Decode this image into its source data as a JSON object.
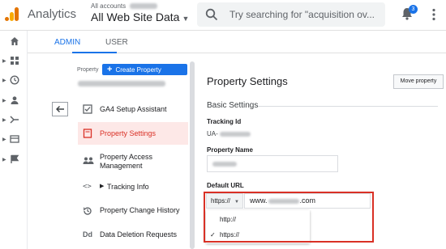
{
  "header": {
    "app_title": "Analytics",
    "account_small": "All accounts",
    "account_main": "All Web Site Data",
    "search_placeholder": "Try searching for \"acquisition ov...",
    "notifications_count": "3"
  },
  "tabs": [
    {
      "label": "ADMIN",
      "active": true
    },
    {
      "label": "USER",
      "active": false
    }
  ],
  "property": {
    "label": "Property",
    "create_button": "Create Property"
  },
  "menu": [
    {
      "label": "GA4 Setup Assistant",
      "icon": "checkbox-icon",
      "selected": false
    },
    {
      "label": "Property Settings",
      "icon": "settings-page-icon",
      "selected": true
    },
    {
      "label": "Property Access Management",
      "icon": "people-icon",
      "selected": false
    },
    {
      "label": "Tracking Info",
      "icon": "code-icon",
      "selected": false
    },
    {
      "label": "Property Change History",
      "icon": "history-icon",
      "selected": false
    },
    {
      "label": "Data Deletion Requests",
      "icon": "dd-icon",
      "selected": false
    }
  ],
  "panel": {
    "title": "Property Settings",
    "move_button": "Move property",
    "section": "Basic Settings",
    "tracking_id_label": "Tracking Id",
    "tracking_id_prefix": "UA-",
    "property_name_label": "Property Name",
    "default_url_label": "Default URL",
    "protocol_selected": "https://",
    "url_prefix": "www.",
    "url_suffix": ".com",
    "protocol_options": [
      "http://",
      "https://"
    ],
    "protocol_checked": "https://"
  },
  "colors": {
    "accent": "#1a73e8",
    "highlight": "#d93025"
  }
}
